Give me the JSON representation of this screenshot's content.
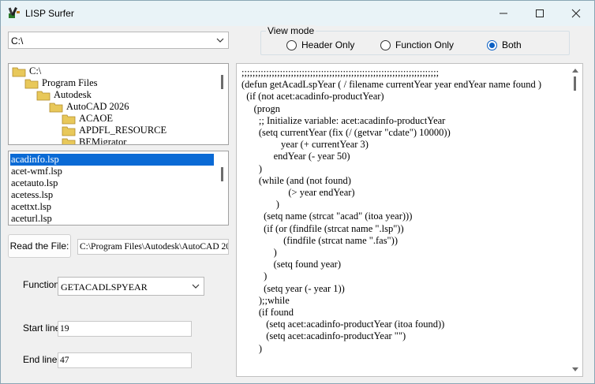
{
  "window": {
    "title": "LISP Surfer",
    "controls": {
      "minimize": "—",
      "maximize": "☐",
      "close": "✕"
    }
  },
  "path_combo": {
    "value": "C:\\"
  },
  "view_mode": {
    "label": "View mode",
    "options": [
      "Header Only",
      "Function Only",
      "Both"
    ],
    "selected": "Both"
  },
  "folder_tree": {
    "items": [
      {
        "label": "C:\\"
      },
      {
        "label": "Program Files"
      },
      {
        "label": "Autodesk"
      },
      {
        "label": "AutoCAD 2026"
      },
      {
        "label": "ACAOE"
      },
      {
        "label": "APDFL_RESOURCE"
      },
      {
        "label": "BEMigrator"
      }
    ]
  },
  "file_list": {
    "items": [
      "acadinfo.lsp",
      "acet-wmf.lsp",
      "acetauto.lsp",
      "acetess.lsp",
      "acettxt.lsp",
      "aceturl.lsp"
    ],
    "selected": "acadinfo.lsp"
  },
  "read_file": {
    "button_label": "Read the File:",
    "path": "C:\\Program Files\\Autodesk\\AutoCAD 20"
  },
  "function": {
    "label": "Function:",
    "value": "GETACADLSPYEAR"
  },
  "start_line": {
    "label": "Start line:",
    "value": "19"
  },
  "end_line": {
    "label": "End line:",
    "value": "47"
  },
  "code_view": {
    "lines": [
      ";;;;;;;;;;;;;;;;;;;;;;;;;;;;;;;;;;;;;;;;;;;;;;;;;;;;;;;;;;;;;;;;;;;;;;;;",
      "(defun getAcadLspYear ( / filename currentYear year endYear name found )",
      "  (if (not acet:acadinfo-productYear)",
      "     (progn",
      "       ;; Initialize variable: acet:acadinfo-productYear",
      "       (setq currentYear (fix (/ (getvar \"cdate\") 10000))",
      "                year (+ currentYear 3)",
      "             endYear (- year 50)",
      "       )",
      "       (while (and (not found)",
      "                   (> year endYear)",
      "              )",
      "         (setq name (strcat \"acad\" (itoa year)))",
      "         (if (or (findfile (strcat name \".lsp\"))",
      "                 (findfile (strcat name \".fas\"))",
      "             )",
      "             (setq found year)",
      "         )",
      "         (setq year (- year 1))",
      "       );;while",
      "       (if found",
      "          (setq acet:acadinfo-productYear (itoa found))",
      "          (setq acet:acadinfo-productYear \"\")",
      "       )"
    ]
  },
  "colors": {
    "selection": "#0a6ad5",
    "radio_accent": "#0a5fc4",
    "folder": "#e8c85a"
  }
}
